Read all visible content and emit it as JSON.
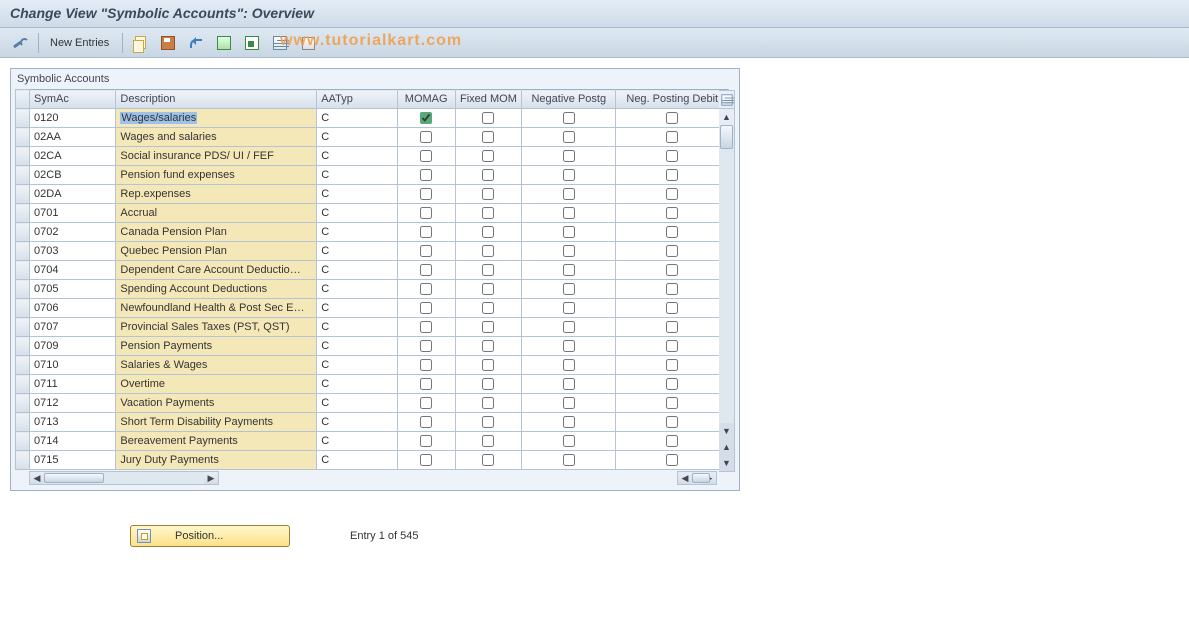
{
  "title": "Change View \"Symbolic Accounts\": Overview",
  "toolbar": {
    "new_entries_label": "New Entries"
  },
  "watermark": "www.tutorialkart.com",
  "group_title": "Symbolic Accounts",
  "columns": {
    "symac": "SymAc",
    "description": "Description",
    "aatyp": "AATyp",
    "momag": "MOMAG",
    "fixed_mom": "Fixed MOM",
    "neg_postg": "Negative Postg",
    "neg_post_debit": "Neg. Posting Debit"
  },
  "rows": [
    {
      "symac": "0120",
      "description": "Wages/salaries",
      "aatyp": "C",
      "momag": true,
      "fixed": false,
      "neg": false,
      "negd": false,
      "selected": true
    },
    {
      "symac": "02AA",
      "description": "Wages and salaries",
      "aatyp": "C",
      "momag": false,
      "fixed": false,
      "neg": false,
      "negd": false
    },
    {
      "symac": "02CA",
      "description": "Social insurance PDS/ UI / FEF",
      "aatyp": "C",
      "momag": false,
      "fixed": false,
      "neg": false,
      "negd": false
    },
    {
      "symac": "02CB",
      "description": "Pension fund expenses",
      "aatyp": "C",
      "momag": false,
      "fixed": false,
      "neg": false,
      "negd": false
    },
    {
      "symac": "02DA",
      "description": "Rep.expenses",
      "aatyp": "C",
      "momag": false,
      "fixed": false,
      "neg": false,
      "negd": false
    },
    {
      "symac": "0701",
      "description": "Accrual",
      "aatyp": "C",
      "momag": false,
      "fixed": false,
      "neg": false,
      "negd": false
    },
    {
      "symac": "0702",
      "description": "Canada Pension Plan",
      "aatyp": "C",
      "momag": false,
      "fixed": false,
      "neg": false,
      "negd": false
    },
    {
      "symac": "0703",
      "description": "Quebec Pension Plan",
      "aatyp": "C",
      "momag": false,
      "fixed": false,
      "neg": false,
      "negd": false
    },
    {
      "symac": "0704",
      "description": "Dependent Care Account Deductio…",
      "aatyp": "C",
      "momag": false,
      "fixed": false,
      "neg": false,
      "negd": false
    },
    {
      "symac": "0705",
      "description": "Spending Account Deductions",
      "aatyp": "C",
      "momag": false,
      "fixed": false,
      "neg": false,
      "negd": false
    },
    {
      "symac": "0706",
      "description": "Newfoundland Health & Post Sec E…",
      "aatyp": "C",
      "momag": false,
      "fixed": false,
      "neg": false,
      "negd": false
    },
    {
      "symac": "0707",
      "description": "Provincial Sales Taxes (PST, QST)",
      "aatyp": "C",
      "momag": false,
      "fixed": false,
      "neg": false,
      "negd": false
    },
    {
      "symac": "0709",
      "description": "Pension Payments",
      "aatyp": "C",
      "momag": false,
      "fixed": false,
      "neg": false,
      "negd": false
    },
    {
      "symac": "0710",
      "description": "Salaries & Wages",
      "aatyp": "C",
      "momag": false,
      "fixed": false,
      "neg": false,
      "negd": false
    },
    {
      "symac": "0711",
      "description": "Overtime",
      "aatyp": "C",
      "momag": false,
      "fixed": false,
      "neg": false,
      "negd": false
    },
    {
      "symac": "0712",
      "description": "Vacation Payments",
      "aatyp": "C",
      "momag": false,
      "fixed": false,
      "neg": false,
      "negd": false
    },
    {
      "symac": "0713",
      "description": "Short Term Disability Payments",
      "aatyp": "C",
      "momag": false,
      "fixed": false,
      "neg": false,
      "negd": false
    },
    {
      "symac": "0714",
      "description": "Bereavement Payments",
      "aatyp": "C",
      "momag": false,
      "fixed": false,
      "neg": false,
      "negd": false
    },
    {
      "symac": "0715",
      "description": "Jury Duty Payments",
      "aatyp": "C",
      "momag": false,
      "fixed": false,
      "neg": false,
      "negd": false
    }
  ],
  "footer": {
    "position_label": "Position...",
    "entry_label": "Entry 1 of 545"
  }
}
